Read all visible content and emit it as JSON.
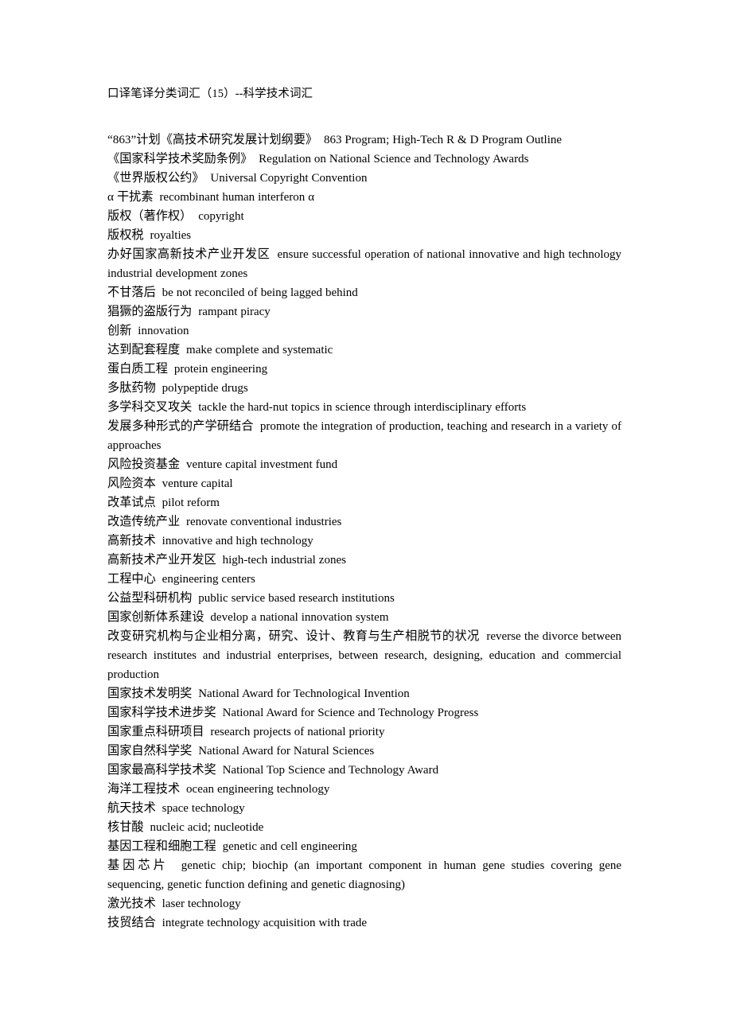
{
  "document": {
    "title": "口译笔译分类词汇（15）--科学技术词汇",
    "separator": "  ",
    "entries": [
      {
        "term": "“863”计划《高技术研究发展计划纲要》",
        "gloss": "863 Program; High-Tech R & D Program Outline"
      },
      {
        "term": "《国家科学技术奖励条例》",
        "gloss": "Regulation on National Science and Technology Awards"
      },
      {
        "term": "《世界版权公约》",
        "gloss": "Universal Copyright Convention"
      },
      {
        "term": "α 干扰素",
        "gloss": "recombinant human interferon  α"
      },
      {
        "term": "版权（著作权）",
        "gloss": "copyright"
      },
      {
        "term": "版权税",
        "gloss": "royalties"
      },
      {
        "term": "办好国家高新技术产业开发区",
        "gloss": "ensure successful operation of national innovative and high technology industrial development zones"
      },
      {
        "term": "不甘落后",
        "gloss": "be not reconciled of being lagged behind"
      },
      {
        "term": "猖獗的盗版行为",
        "gloss": "rampant piracy"
      },
      {
        "term": "创新",
        "gloss": "innovation"
      },
      {
        "term": "达到配套程度",
        "gloss": "make complete and systematic"
      },
      {
        "term": "蛋白质工程",
        "gloss": "protein engineering"
      },
      {
        "term": "多肽药物",
        "gloss": "polypeptide drugs"
      },
      {
        "term": "多学科交叉攻关",
        "gloss": "tackle the hard-nut topics in science through interdisciplinary efforts"
      },
      {
        "term": "发展多种形式的产学研结合",
        "gloss": "promote the integration of production, teaching and research in a variety of approaches"
      },
      {
        "term": "风险投资基金",
        "gloss": "venture capital investment fund"
      },
      {
        "term": "风险资本",
        "gloss": "venture capital"
      },
      {
        "term": "改革试点",
        "gloss": "pilot reform"
      },
      {
        "term": "改造传统产业",
        "gloss": "renovate conventional industries"
      },
      {
        "term": "高新技术",
        "gloss": "innovative and high technology"
      },
      {
        "term": "高新技术产业开发区",
        "gloss": "high-tech industrial zones"
      },
      {
        "term": "工程中心",
        "gloss": "engineering centers"
      },
      {
        "term": "公益型科研机构",
        "gloss": "public service based research institutions"
      },
      {
        "term": "国家创新体系建设",
        "gloss": "develop a national innovation system"
      },
      {
        "term": "改变研究机构与企业相分离，研究、设计、教育与生产相脱节的状况",
        "gloss": "reverse the divorce between research institutes and industrial enterprises, between research, designing, education and commercial production"
      },
      {
        "term": "国家技术发明奖",
        "gloss": "National Award for Technological Invention"
      },
      {
        "term": "国家科学技术进步奖",
        "gloss": "National Award for Science and Technology Progress"
      },
      {
        "term": "国家重点科研项目",
        "gloss": "research projects of national priority"
      },
      {
        "term": "国家自然科学奖",
        "gloss": "National Award for Natural Sciences"
      },
      {
        "term": "国家最高科学技术奖",
        "gloss": "National Top Science and Technology Award"
      },
      {
        "term": "海洋工程技术",
        "gloss": "ocean engineering technology"
      },
      {
        "term": "航天技术",
        "gloss": "space technology"
      },
      {
        "term": "核甘酸",
        "gloss": "nucleic acid; nucleotide"
      },
      {
        "term": "基因工程和细胞工程",
        "gloss": "genetic and cell engineering"
      },
      {
        "term": "基因芯片",
        "gloss": "genetic chip; biochip (an important component in human gene studies covering gene sequencing, genetic function defining and genetic diagnosing)"
      },
      {
        "term": "激光技术",
        "gloss": "laser technology"
      },
      {
        "term": "技贸结合",
        "gloss": "integrate technology acquisition with trade"
      }
    ]
  }
}
